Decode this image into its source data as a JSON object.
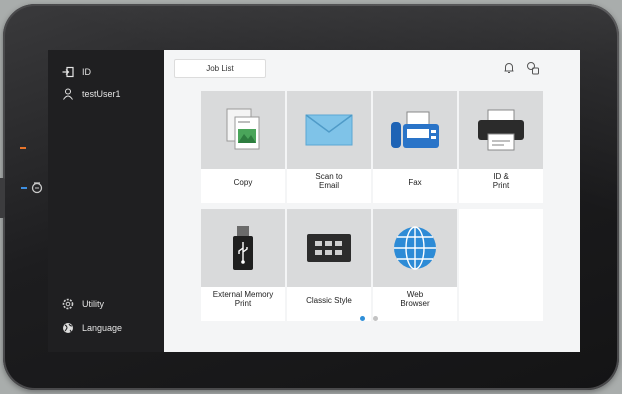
{
  "sidebar": {
    "id_label": "ID",
    "user_label": "testUser1",
    "utility_label": "Utility",
    "language_label": "Language"
  },
  "header": {
    "job_list_label": "Job List"
  },
  "tiles": [
    {
      "label": "Copy",
      "icon": "copy-icon"
    },
    {
      "label": "Scan to\nEmail",
      "icon": "envelope-icon"
    },
    {
      "label": "Fax",
      "icon": "fax-icon"
    },
    {
      "label": "ID &\nPrint",
      "icon": "printer-icon"
    },
    {
      "label": "External Memory\nPrint",
      "icon": "usb-drive-icon"
    },
    {
      "label": "Classic Style",
      "icon": "keypad-icon"
    },
    {
      "label": "Web\nBrowser",
      "icon": "globe-icon"
    }
  ],
  "pagination": {
    "pages": 2,
    "current": 1
  },
  "colors": {
    "accent": "#2f8fd8",
    "bezel": "#1d1d1f",
    "sidebar": "#1f1f21",
    "tile_bg": "#d9dadb"
  }
}
